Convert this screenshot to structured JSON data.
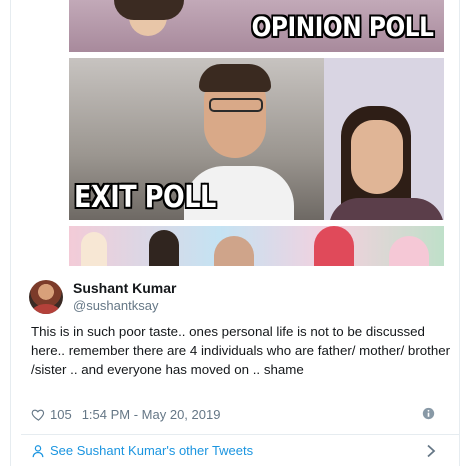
{
  "media": {
    "top_label": "OPINION POLL",
    "middle_label": "EXIT POLL"
  },
  "author": {
    "name": "Sushant Kumar",
    "handle": "@sushantksay"
  },
  "tweet": {
    "text": "This is in such poor taste.. ones personal life is not to be discussed here.. remember there are 4 individuals who are father/ mother/ brother /sister .. and everyone has moved on .. shame",
    "likes": "105",
    "timestamp": "1:54 PM - May 20, 2019"
  },
  "footer": {
    "link_label": "See Sushant Kumar's other Tweets"
  },
  "colors": {
    "link": "#1b95e0",
    "muted": "#657786",
    "text": "#14171a"
  },
  "icons": [
    "heart-icon",
    "info-icon",
    "person-icon",
    "chevron-right-icon"
  ]
}
